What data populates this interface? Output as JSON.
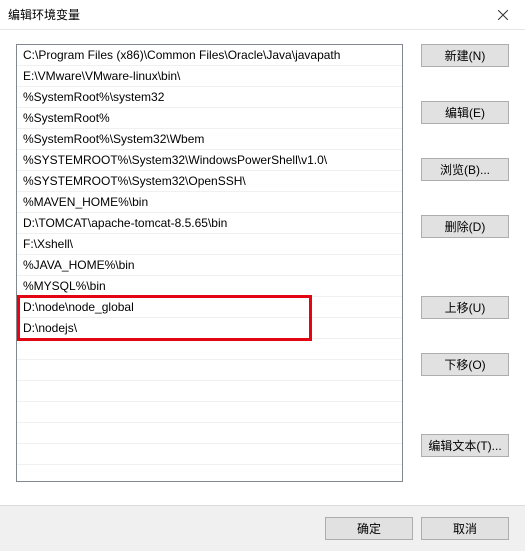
{
  "titlebar": {
    "title": "编辑环境变量"
  },
  "list": {
    "items": [
      "C:\\Program Files (x86)\\Common Files\\Oracle\\Java\\javapath",
      "E:\\VMware\\VMware-linux\\bin\\",
      "%SystemRoot%\\system32",
      "%SystemRoot%",
      "%SystemRoot%\\System32\\Wbem",
      "%SYSTEMROOT%\\System32\\WindowsPowerShell\\v1.0\\",
      "%SYSTEMROOT%\\System32\\OpenSSH\\",
      "%MAVEN_HOME%\\bin",
      "D:\\TOMCAT\\apache-tomcat-8.5.65\\bin",
      "F:\\Xshell\\",
      "%JAVA_HOME%\\bin",
      "%MYSQL%\\bin",
      "D:\\node\\node_global",
      "D:\\nodejs\\"
    ],
    "highlight": {
      "start_index": 12,
      "end_index": 13,
      "color": "#e20613"
    }
  },
  "buttons": {
    "new": "新建(N)",
    "edit": "编辑(E)",
    "browse": "浏览(B)...",
    "delete": "删除(D)",
    "move_up": "上移(U)",
    "move_down": "下移(O)",
    "edit_text": "编辑文本(T)..."
  },
  "footer": {
    "ok": "确定",
    "cancel": "取消"
  }
}
